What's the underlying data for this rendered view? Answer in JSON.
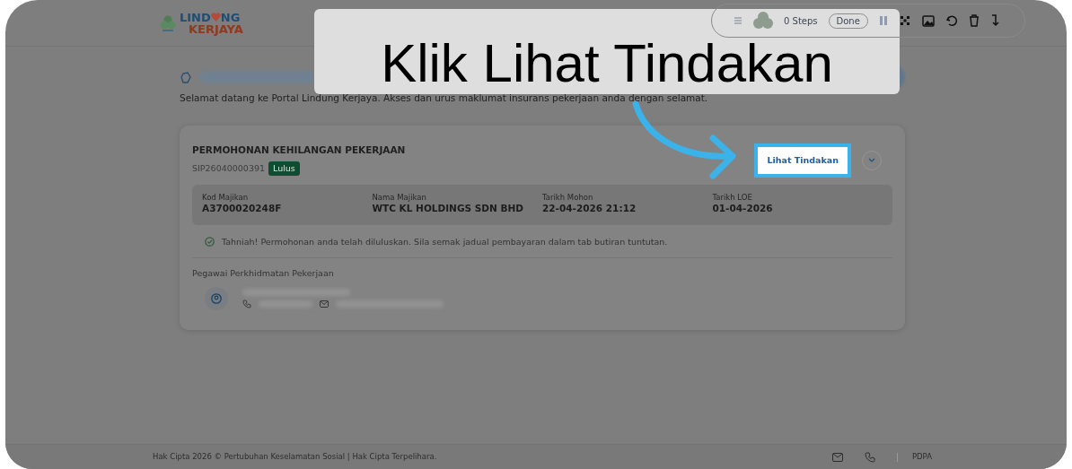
{
  "header": {
    "logo": {
      "word_1_start": "LIND",
      "word_1_end": "NG",
      "word_2": "KERJAYA"
    }
  },
  "recorder_toolbar": {
    "steps": "0 Steps",
    "done": "Done"
  },
  "caption": "Klik Lihat Tindakan",
  "welcome": "Selamat datang ke Portal Lindung Kerjaya. Akses dan urus maklumat insurans pekerjaan anda dengan selamat.",
  "application": {
    "title": "PERMOHONAN KEHILANGAN PEKERJAAN",
    "reference": "SIP26040000391",
    "status": "Lulus",
    "action": {
      "label": "Lihat Tindakan",
      "highlighted": true
    },
    "fields": [
      {
        "label": "Kod Majikan",
        "value": "A3700020248F"
      },
      {
        "label": "Nama Majikan",
        "value": "WTC KL HOLDINGS SDN BHD"
      },
      {
        "label": "Tarikh Mohon",
        "value": "22-04-2026 21:12"
      },
      {
        "label": "Tarikh LOE",
        "value": "01-04-2026"
      }
    ],
    "message": "Tahniah! Permohonan anda telah diluluskan. Sila semak jadual pembayaran dalam tab butiran tuntutan.",
    "officer_heading": "Pegawai Perkhidmatan Pekerjaan"
  },
  "footer": {
    "copyright": "Hak Cipta 2026 © Pertubuhan Keselamatan Sosial | Hak Cipta Terpelihara.",
    "link": "PDPA"
  }
}
